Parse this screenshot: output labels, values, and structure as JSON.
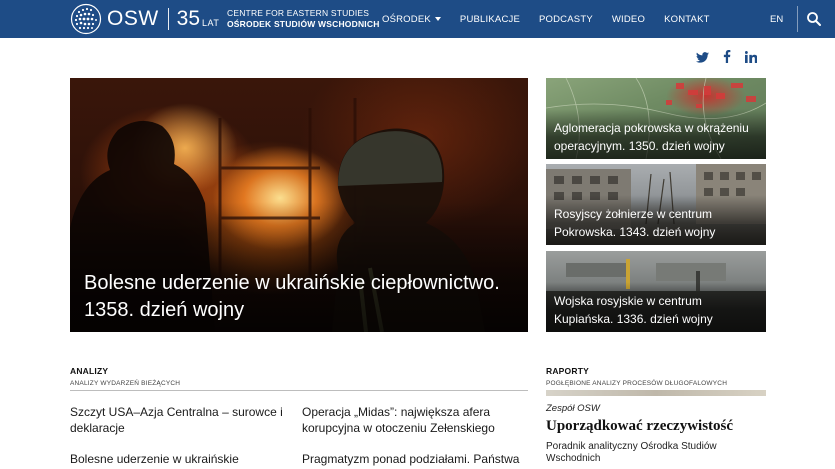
{
  "header": {
    "logo_text": "OSW",
    "anniversary_number": "35",
    "anniversary_suffix": "LAT",
    "org_name_en": "CENTRE FOR EASTERN STUDIES",
    "org_name_pl": "OŚRODEK STUDIÓW WSCHODNICH",
    "nav": [
      {
        "label": "OŚRODEK",
        "has_dropdown": true
      },
      {
        "label": "PUBLIKACJE"
      },
      {
        "label": "PODCASTY"
      },
      {
        "label": "WIDEO"
      },
      {
        "label": "KONTAKT"
      }
    ],
    "language": "EN",
    "brand_color": "#1e4c86"
  },
  "social": [
    "twitter-icon",
    "facebook-icon",
    "linkedin-icon"
  ],
  "hero": {
    "title": "Bolesne uderzenie w ukraińskie ciepłownictwo. 1358. dzień wojny"
  },
  "side_cards": [
    {
      "title": "Aglomeracja pokrowska w okrążeniu operacyjnym. 1350. dzień wojny"
    },
    {
      "title": "Rosyjscy żołnierze w centrum Pokrowska. 1343. dzień wojny"
    },
    {
      "title": "Wojska rosyjskie w centrum Kupiańska. 1336. dzień wojny"
    }
  ],
  "analizy": {
    "heading": "ANALIZY",
    "subheading": "ANALIZY WYDARZEŃ BIEŻĄCYCH",
    "articles": [
      {
        "title": "Szczyt USA–Azja Centralna – surowce i deklaracje"
      },
      {
        "title": "Operacja „Midas”: największa afera korupcyjna w otoczeniu Zełenskiego"
      },
      {
        "title": "Bolesne uderzenie w ukraińskie"
      },
      {
        "title": "Pragmatyzm ponad podziałami. Państwa"
      }
    ]
  },
  "raporty": {
    "heading": "RAPORTY",
    "subheading": "POGŁĘBIONE ANALIZY PROCESÓW DŁUGOFALOWYCH",
    "author": "Zespół OSW",
    "title": "Uporządkować rzeczywistość",
    "description": "Poradnik analityczny Ośrodka Studiów Wschodnich"
  }
}
